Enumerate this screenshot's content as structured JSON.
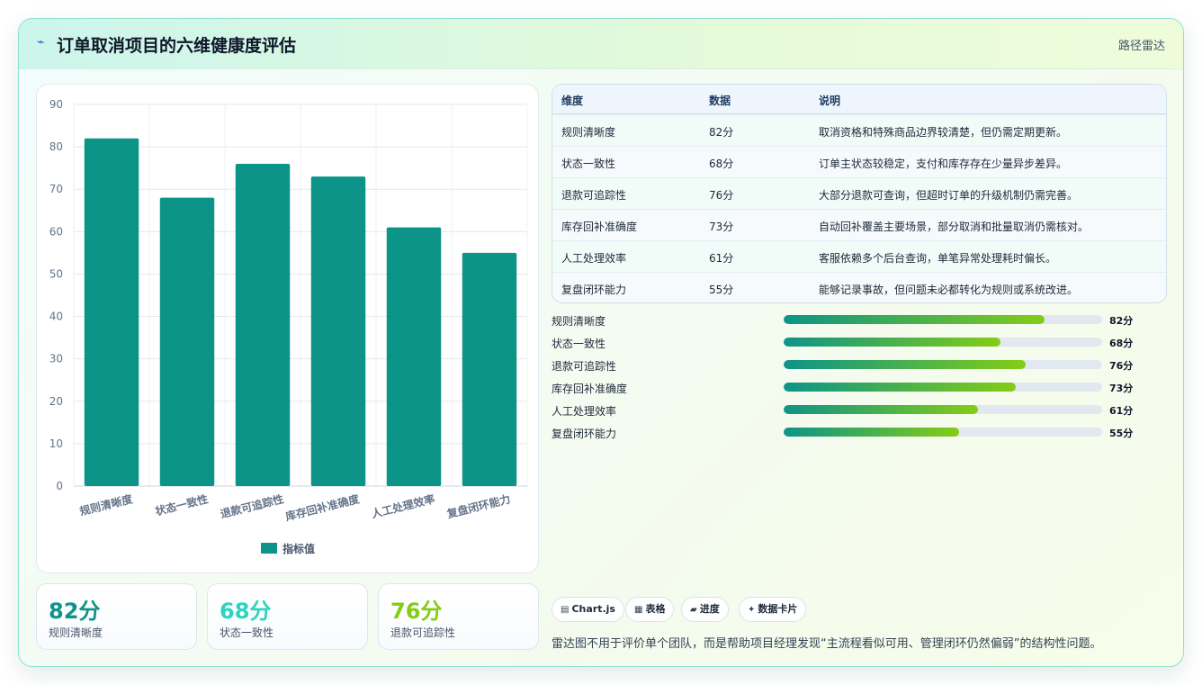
{
  "header": {
    "icon": "pulse-icon",
    "title": "订单取消项目的六维健康度评估",
    "tag": "路径雷达"
  },
  "chart_data": {
    "type": "bar",
    "categories": [
      "规则清晰度",
      "状态一致性",
      "退款可追踪性",
      "库存回补准确度",
      "人工处理效率",
      "复盘闭环能力"
    ],
    "series": [
      {
        "name": "指标值",
        "values": [
          82,
          68,
          76,
          73,
          61,
          55
        ],
        "color": "#0d9488"
      }
    ],
    "ylim": [
      0,
      90
    ],
    "yticks": [
      0,
      10,
      20,
      30,
      40,
      50,
      60,
      70,
      80,
      90
    ],
    "grid": true,
    "legend": "bottom"
  },
  "stats": [
    {
      "value": "82分",
      "label": "规则清晰度",
      "color": "#0d9488"
    },
    {
      "value": "68分",
      "label": "状态一致性",
      "color": "#2dd4bf"
    },
    {
      "value": "76分",
      "label": "退款可追踪性",
      "color": "#84cc16"
    }
  ],
  "table": {
    "headers": [
      "维度",
      "数据",
      "说明"
    ],
    "rows": [
      [
        "规则清晰度",
        "82分",
        "取消资格和特殊商品边界较清楚，但仍需定期更新。"
      ],
      [
        "状态一致性",
        "68分",
        "订单主状态较稳定，支付和库存存在少量异步差异。"
      ],
      [
        "退款可追踪性",
        "76分",
        "大部分退款可查询，但超时订单的升级机制仍需完善。"
      ],
      [
        "库存回补准确度",
        "73分",
        "自动回补覆盖主要场景，部分取消和批量取消仍需核对。"
      ],
      [
        "人工处理效率",
        "61分",
        "客服依赖多个后台查询，单笔异常处理耗时偏长。"
      ],
      [
        "复盘闭环能力",
        "55分",
        "能够记录事故，但问题未必都转化为规则或系统改进。"
      ]
    ]
  },
  "progress": [
    {
      "label": "规则清晰度",
      "value": 82,
      "text": "82分"
    },
    {
      "label": "状态一致性",
      "value": 68,
      "text": "68分"
    },
    {
      "label": "退款可追踪性",
      "value": 76,
      "text": "76分"
    },
    {
      "label": "库存回补准确度",
      "value": 73,
      "text": "73分"
    },
    {
      "label": "人工处理效率",
      "value": 61,
      "text": "61分"
    },
    {
      "label": "复盘闭环能力",
      "value": 55,
      "text": "55分"
    }
  ],
  "chips": [
    {
      "icon": "chart-icon",
      "glyph": "▤",
      "label": "Chart.js"
    },
    {
      "icon": "table-icon",
      "glyph": "▦",
      "label": "表格"
    },
    {
      "icon": "progress-icon",
      "glyph": "▰",
      "label": "进度"
    },
    {
      "icon": "card-icon",
      "glyph": "✦",
      "label": "数据卡片"
    }
  ],
  "footnote": "雷达图不用于评价单个团队，而是帮助项目经理发现“主流程看似可用、管理闭环仍然偏弱”的结构性问题。"
}
